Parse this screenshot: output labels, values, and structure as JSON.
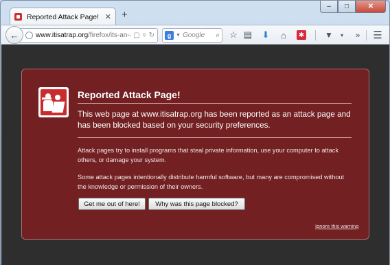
{
  "window": {
    "caption_min": "–",
    "caption_max": "□",
    "caption_close": "✕"
  },
  "tab": {
    "title": "Reported Attack Page!",
    "close": "✕",
    "new_tab": "+"
  },
  "navbar": {
    "back": "←",
    "url_host": "www.itisatrap.org",
    "url_path": "/firefox/its-an-att",
    "search_placeholder": "Google",
    "search_engine": "g",
    "icons": {
      "star": "☆",
      "clipboard": "▤",
      "download": "⬇",
      "home": "⌂",
      "extension": "✱",
      "pocket": "▼",
      "dropdown": "▾",
      "overflow": "»",
      "menu": "☰",
      "reader": "▢",
      "url_drop": "▿",
      "search": "⌕"
    }
  },
  "warning": {
    "title": "Reported Attack Page!",
    "lead": "This web page at www.itisatrap.org has been reported as an attack page and has been blocked based on your security preferences.",
    "para1": "Attack pages try to install programs that steal private information, use your computer to attack others, or damage your system.",
    "para2": "Some attack pages intentionally distribute harmful software, but many are compromised without the knowledge or permission of their owners.",
    "get_me_out": "Get me out of here!",
    "why_blocked": "Why was this page blocked?",
    "ignore": "Ignore this warning"
  },
  "colors": {
    "panel_bg": "#722022",
    "page_bg": "#2e2e2e",
    "badge_red": "#c82c2c"
  }
}
